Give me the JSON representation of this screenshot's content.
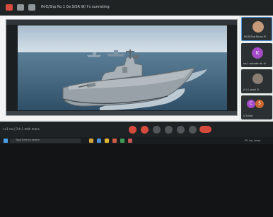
{
  "meeting": {
    "title": "IN-E/Shp Ro 1 0a S/SR W/ I's sunneting"
  },
  "video": {
    "scene": "warship-at-sea"
  },
  "participants": [
    {
      "name": "INI-E/Shp Ro.se PI",
      "avatar_initial": "",
      "avatar_color": "#c69b7a"
    },
    {
      "name": "no.l. solurde rd. al",
      "avatar_initial": "K",
      "avatar_color": "#a54bc7"
    },
    {
      "name": "A I S sourt D.",
      "avatar_initial": "",
      "avatar_color": "#8a7e74"
    },
    {
      "name": "U Lniue",
      "avatar_initial": "C",
      "avatar_color": "#a54bc7",
      "avatar_initial_2": "S",
      "avatar_color_2": "#c8642e"
    }
  ],
  "controls": {
    "time": "r:c1 res | 3:h 1 mhh mens"
  },
  "taskbar": {
    "search_placeholder": "Type here to search",
    "tray_text": "IPL tqc Lesss"
  },
  "colors": {
    "accent_red": "#d64a3e",
    "dark": "#1e2224",
    "light_bg": "#e9ecec",
    "water": "#4a6f8c",
    "sky": "#c8d7e3"
  }
}
